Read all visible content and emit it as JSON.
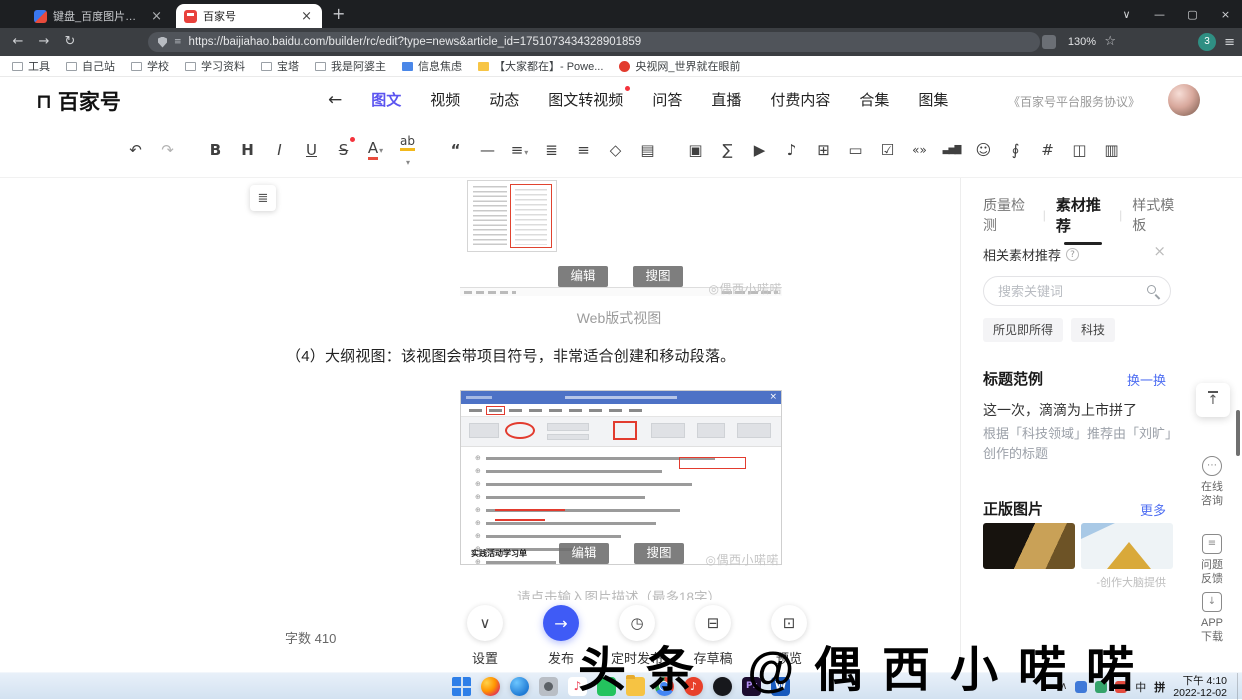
{
  "icons": {
    "caret": "▾",
    "chevron_down": "∨",
    "minimize": "—",
    "maximize": "▢",
    "close": "×",
    "back": "←",
    "forward": "→",
    "reload": "↻",
    "star": "☆",
    "menu": "≡",
    "new_tab": "+",
    "tray_chevron": "∧",
    "dots": "⋯",
    "arrow_up": "↑",
    "arrow_down": "↓",
    "list_lines": "≡",
    "question": "?",
    "logo_mark": "⊓",
    "note": "♪",
    "settings_chevron": "∨",
    "publish_arrow": "→",
    "clock": "◷",
    "draft_box": "⊟",
    "preview_screen": "⊡",
    "outline_toggle": "≣",
    "pr": "Pr",
    "word": "W"
  },
  "browser": {
    "tab1": "键盘_百度图片搜索",
    "tab2": "百家号",
    "url": "https://baijiahao.baidu.com/builder/rc/edit?type=news&article_id=1751073434328901859",
    "zoom": "130%",
    "profile_badge": "3",
    "bookmarks": [
      "工具",
      "自己站",
      "学校",
      "学习资料",
      "宝塔",
      "我是阿婆主",
      "信息焦虑",
      "【大家都在】- Powe...",
      "央视网_世界就在眼前"
    ]
  },
  "header": {
    "logo": "百家号",
    "nav": [
      "图文",
      "视频",
      "动态",
      "图文转视频",
      "问答",
      "直播",
      "付费内容",
      "合集",
      "图集"
    ],
    "agreement": "《百家号平台服务协议》"
  },
  "toolbar": {
    "icons": [
      {
        "name": "undo",
        "glyph": "↶"
      },
      {
        "name": "redo",
        "glyph": "↷"
      },
      {
        "name": "bold",
        "glyph": "B"
      },
      {
        "name": "heading",
        "glyph": "H"
      },
      {
        "name": "italic",
        "glyph": "I"
      },
      {
        "name": "underline",
        "glyph": "U"
      },
      {
        "name": "strikethrough",
        "glyph": "S"
      },
      {
        "name": "font-color",
        "glyph": "A"
      },
      {
        "name": "highlight",
        "glyph": "ab"
      },
      {
        "name": "blockquote",
        "glyph": "“"
      },
      {
        "name": "divider",
        "glyph": "—"
      },
      {
        "name": "align",
        "glyph": "≡"
      },
      {
        "name": "ordered-list",
        "glyph": "≣"
      },
      {
        "name": "unordered-list",
        "glyph": "≡"
      },
      {
        "name": "format-clear",
        "glyph": "◇"
      },
      {
        "name": "word-import",
        "glyph": "▤"
      },
      {
        "name": "image",
        "glyph": "▣"
      },
      {
        "name": "formula",
        "glyph": "∑"
      },
      {
        "name": "video",
        "glyph": "▶"
      },
      {
        "name": "audio",
        "glyph": "♪"
      },
      {
        "name": "table",
        "glyph": "⊞"
      },
      {
        "name": "card",
        "glyph": "▭"
      },
      {
        "name": "vote",
        "glyph": "☑"
      },
      {
        "name": "quote-card",
        "glyph": "«»"
      },
      {
        "name": "chart",
        "glyph": "▃▅▇"
      },
      {
        "name": "emoji",
        "glyph": "☺"
      },
      {
        "name": "link",
        "glyph": "∮"
      },
      {
        "name": "topic",
        "glyph": "#"
      },
      {
        "name": "bookmark",
        "glyph": "◫"
      },
      {
        "name": "page",
        "glyph": "▥"
      }
    ]
  },
  "editor": {
    "edit_btn": "编辑",
    "search_btn": "搜图",
    "watermark_small": "◎偶西小喏喏",
    "caption1": "Web版式视图",
    "paragraph": "（4）大纲视图：该视图会带项目符号，非常适合创建和移动段落。",
    "doc_label": "实践活动学习单",
    "caption_placeholder": "请点击输入图片描述（最多18字）"
  },
  "footer": {
    "word_count_label": "字数",
    "word_count": "410",
    "settings": "设置",
    "publish": "发布",
    "schedule": "定时发布",
    "draft": "存草稿",
    "preview": "预览"
  },
  "panel": {
    "tab_quality": "质量检测",
    "tab_material": "素材推荐",
    "tab_style": "样式模板",
    "section_related": "相关素材推荐",
    "search_placeholder": "搜索关键词",
    "tag1": "所见即所得",
    "tag2": "科技",
    "heading_titles": "标题范例",
    "refresh": "换一换",
    "example_title": "这一次，滴滴为上市拼了",
    "example_desc": "根据「科技领域」推荐由「刘旷」创作的标题",
    "heading_images": "正版图片",
    "more": "更多",
    "provider": "-创作大脑提供"
  },
  "rail": {
    "consult": "在线咨询",
    "feedback": "问题反馈",
    "app": "APP下载"
  },
  "watermark_big": "头条 @偶西小喏喏",
  "taskbar": {
    "lang": "中",
    "ime": "拼",
    "time": "下午 4:10",
    "date": "2022-12-02"
  }
}
